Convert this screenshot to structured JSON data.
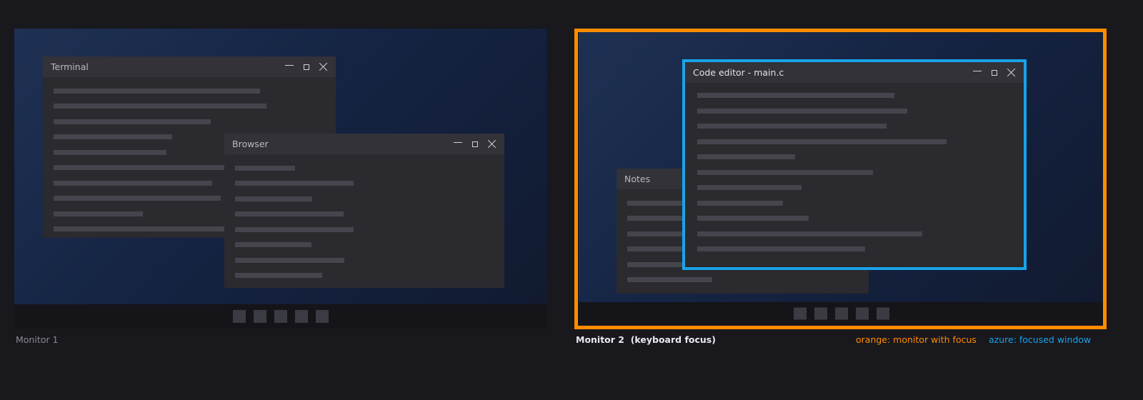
{
  "monitors": [
    {
      "label": "Monitor 1",
      "windows": {
        "terminal": {
          "title": "Terminal"
        },
        "browser": {
          "title": "Browser"
        }
      }
    },
    {
      "label": "Monitor 2  (keyboard focus)",
      "windows": {
        "notes": {
          "title": "Notes"
        },
        "editor": {
          "title": "Code editor - main.c"
        }
      }
    }
  ],
  "legend": {
    "orange": "orange: monitor with focus",
    "azure": "azure: focused window"
  },
  "colors": {
    "monitor_focus": "#ff8c00",
    "window_focus": "#1aa3e8"
  },
  "window_controls": [
    "minimize-icon",
    "maximize-icon",
    "close-icon"
  ]
}
